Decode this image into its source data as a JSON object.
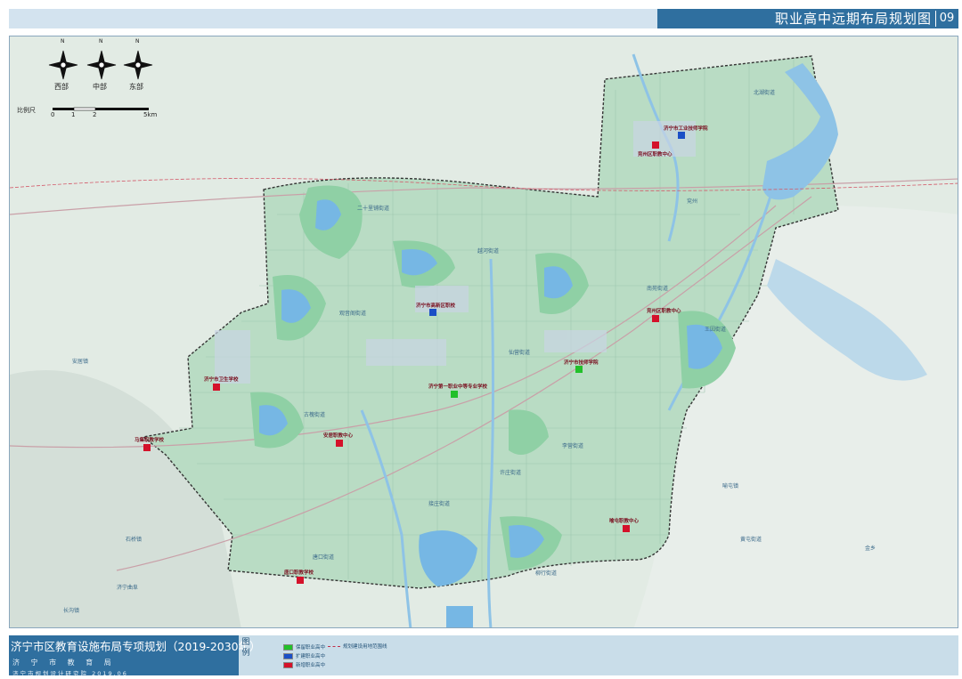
{
  "header": {
    "title": "职业高中远期布局规划图",
    "page_number": "09"
  },
  "footer": {
    "title": "济宁市区教育设施布局专项规划（2019-2030年）",
    "org1": "济 宁 市 教 育 局",
    "org2": "济宁市规划设计研究院 2019.06"
  },
  "legend": {
    "title": "图例",
    "items": [
      {
        "label": "保留职业高中",
        "color": "#22c02a"
      },
      {
        "label": "扩建职业高中",
        "color": "#1b4fc6"
      },
      {
        "label": "新增职业高中",
        "color": "#d4112a"
      }
    ],
    "boundary_label": "规划建设用地范围线"
  },
  "compass": {
    "north": "N",
    "labels": [
      "西部",
      "中部",
      "东部"
    ]
  },
  "scale_bar": {
    "label": "比例尺",
    "ticks": [
      "0",
      "1",
      "2",
      "5km"
    ]
  },
  "map": {
    "area_labels": [
      "北湖街道",
      "南苑街道",
      "越河街道",
      "王因街道",
      "古槐街道",
      "仙营街道",
      "唐口街道",
      "柳行街道",
      "李营街道",
      "喻屯镇",
      "观音阁街道",
      "接庄街道",
      "许庄街道",
      "石桥镇",
      "长沟镇",
      "安居镇",
      "二十里铺街道",
      "黄屯街道",
      "兖州",
      "金乡",
      "济宁曲阜"
    ],
    "schools": [
      {
        "name": "济宁市工业技师学院",
        "type": "扩建"
      },
      {
        "name": "兖州区职教中心",
        "type": "新增"
      },
      {
        "name": "济宁市高新区职校",
        "type": "扩建"
      },
      {
        "name": "兖州区职教中心",
        "type": "新增"
      },
      {
        "name": "济宁市卫生学校",
        "type": "新增"
      },
      {
        "name": "济宁市技师学院",
        "type": "保留"
      },
      {
        "name": "济宁第一职业中等专业学校",
        "type": "保留"
      },
      {
        "name": "马集职教学校",
        "type": "新增"
      },
      {
        "name": "安居职教中心",
        "type": "新增"
      },
      {
        "name": "喻屯职教中心",
        "type": "新增"
      },
      {
        "name": "唐口职教学校",
        "type": "新增"
      }
    ]
  }
}
